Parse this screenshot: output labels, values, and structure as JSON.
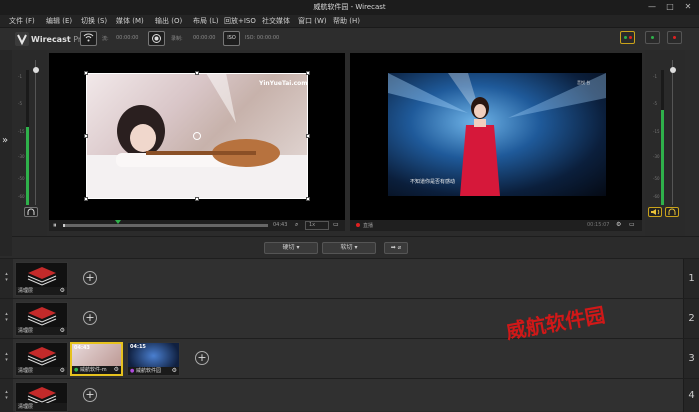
{
  "window": {
    "title": "威航软件园 - Wirecast"
  },
  "menu": [
    "文件 (F)",
    "编辑 (E)",
    "切换 (S)",
    "媒体 (M)",
    "输出 (O)",
    "布局 (L)",
    "回放+ISO",
    "社交媒体",
    "窗口 (W)",
    "帮助 (H)"
  ],
  "app": {
    "logo": "Wirecast",
    "edition": "Pro"
  },
  "toolbar": {
    "stream_label": "流:",
    "stream_time": "00:00:00",
    "record_label": "录制:",
    "record_time": "00:00:00",
    "iso_badge": "ISO",
    "iso_time": "ISO: 00:00:00"
  },
  "meters": {
    "ticks": [
      "-1",
      "-5",
      "-15",
      "-30",
      "-50",
      "-60"
    ]
  },
  "preview": {
    "watermark": "YinYueTai.com",
    "time": "04:43",
    "rate": "1x"
  },
  "program": {
    "caption": "不知道你是否有感动",
    "corner": "音悦 台",
    "live_label": "直播",
    "time": "00:15:07"
  },
  "transition": {
    "cut": "硬切",
    "smooth": "软切",
    "go": "➡ ⌀"
  },
  "layers": [
    {
      "number": "1",
      "shots": [
        {
          "label": "清理层"
        }
      ]
    },
    {
      "number": "2",
      "shots": [
        {
          "label": "清理层"
        }
      ]
    },
    {
      "number": "3",
      "shots": [
        {
          "label": "清理层"
        },
        {
          "label": "威航软件-m",
          "time": "04:43"
        },
        {
          "label": "威航软件园",
          "time": "04:15"
        }
      ]
    },
    {
      "number": "4",
      "shots": [
        {
          "label": "清理层"
        }
      ]
    }
  ],
  "overlay": {
    "watermark": "威航软件园"
  },
  "colors": {
    "accent_tally": "#c9a21a",
    "live_red": "#e02020",
    "meter_green": "#2fb14b"
  }
}
